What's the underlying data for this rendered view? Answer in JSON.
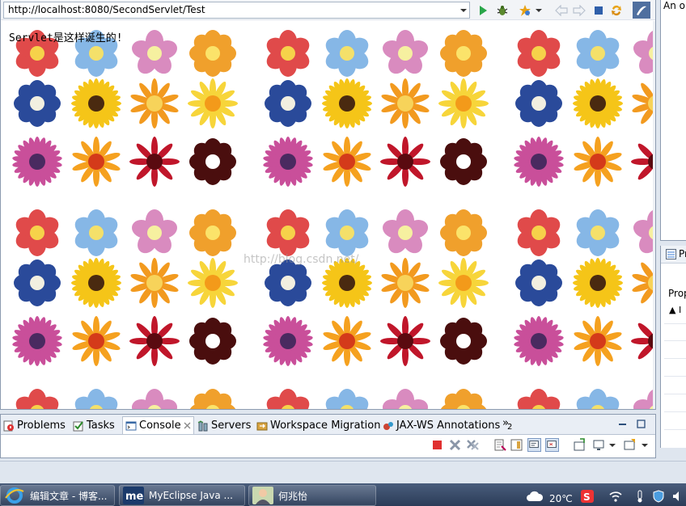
{
  "browser": {
    "url": "http://localhost:8080/SecondServlet/Test",
    "page_text": "Servlet是这样诞生的!",
    "watermark": "http://blog.csdn.net/"
  },
  "right_panel": {
    "outline_text": "An o",
    "properties_tab": "Pr",
    "properties_column": "Prop",
    "properties_row": "▲ I"
  },
  "views": {
    "tabs": [
      {
        "label": "Problems",
        "icon": "problems-icon"
      },
      {
        "label": "Tasks",
        "icon": "tasks-icon"
      },
      {
        "label": "Console",
        "icon": "console-icon",
        "active": true
      },
      {
        "label": "Servers",
        "icon": "servers-icon"
      },
      {
        "label": "Workspace Migration",
        "icon": "migration-icon"
      },
      {
        "label": "JAX-WS Annotations",
        "icon": "jaxws-icon"
      }
    ],
    "overflow_count": "2"
  },
  "taskbar": {
    "items": [
      {
        "label": "编辑文章 - 博客..."
      },
      {
        "label": "MyEclipse Java ..."
      },
      {
        "label": "何兆怡"
      }
    ],
    "temperature": "20℃"
  },
  "colors": {
    "accent": "#3366cc",
    "run_green": "#2aa64a",
    "stop_red": "#e03030"
  }
}
